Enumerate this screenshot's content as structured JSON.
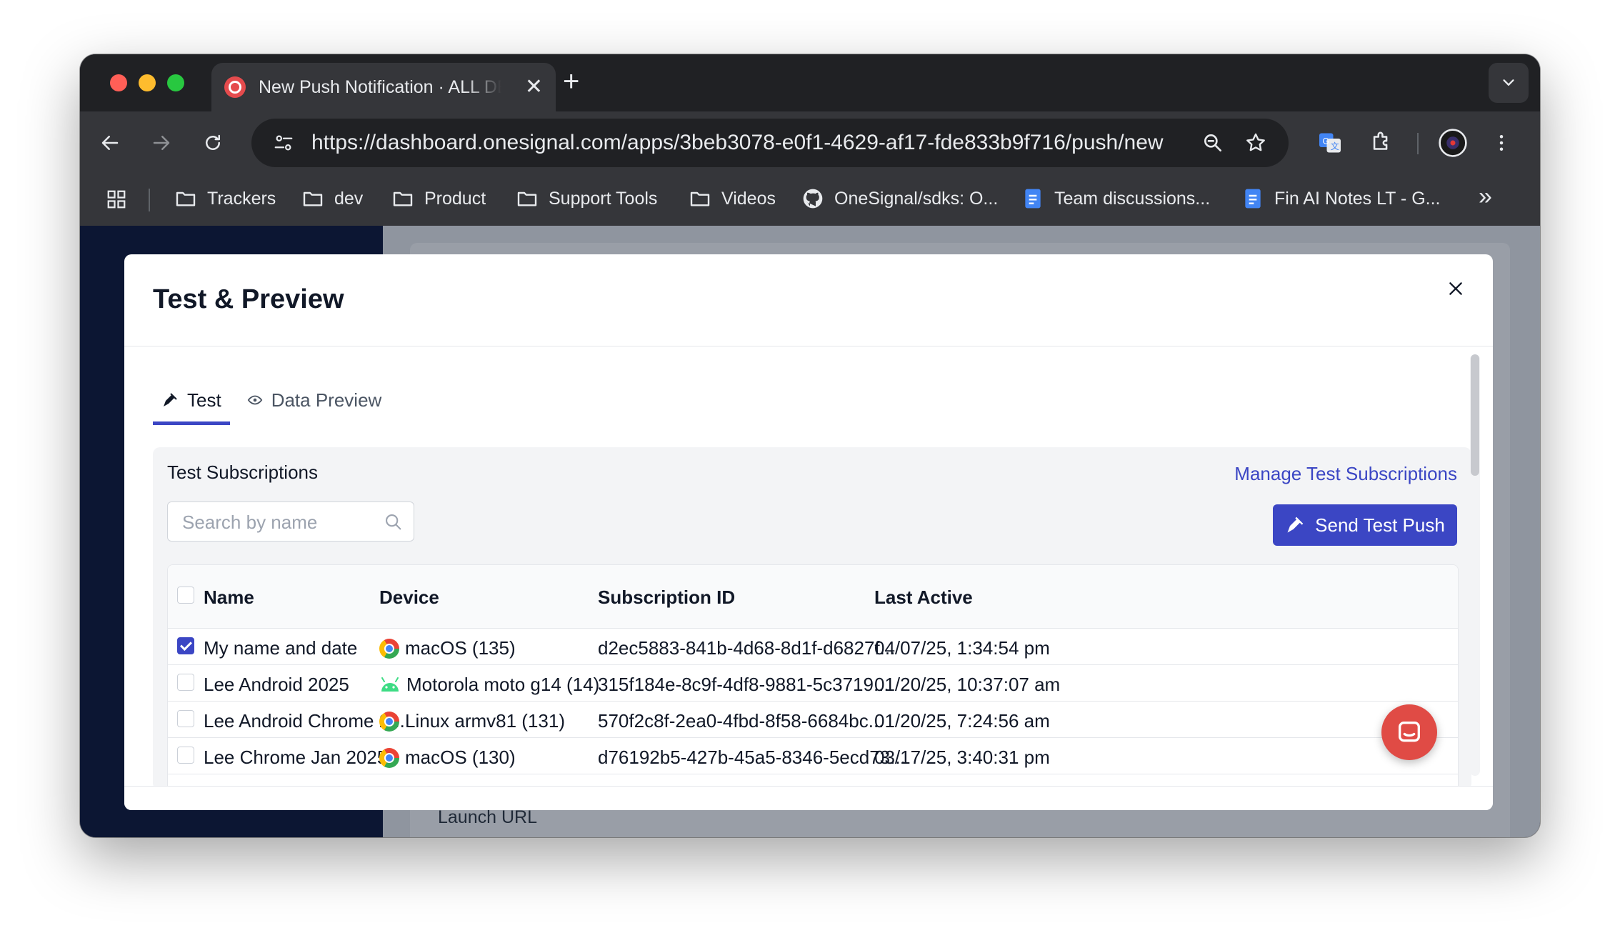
{
  "browser": {
    "tab_title": "New Push Notification · ALL DEVICES",
    "tab_close": "✕",
    "new_tab": "+",
    "url": "https://dashboard.onesignal.com/apps/3beb3078-e0f1-4629-af17-fde833b9f716/push/new",
    "bookmarks": [
      "Trackers",
      "dev",
      "Product",
      "Support Tools",
      "Videos",
      "OneSignal/sdks: O...",
      "Team discussions...",
      "Fin AI Notes LT - G..."
    ],
    "more_bookmarks": "»"
  },
  "page": {
    "launch_url_label": "Launch URL"
  },
  "modal": {
    "title": "Test & Preview",
    "tabs": [
      {
        "label": "Test",
        "icon": "send-icon",
        "active": true
      },
      {
        "label": "Data Preview",
        "icon": "eye-icon",
        "active": false
      }
    ],
    "section_title": "Test Subscriptions",
    "manage_link": "Manage Test Subscriptions",
    "search_placeholder": "Search by name",
    "send_button": "Send Test Push",
    "columns": [
      "Name",
      "Device",
      "Subscription ID",
      "Last Active"
    ],
    "rows": [
      {
        "checked": true,
        "name": "My name and date",
        "device_icon": "chrome-icon",
        "device": "macOS (135)",
        "subscription_id": "d2ec5883-841b-4d68-8d1f-d6827f...",
        "last_active": "04/07/25, 1:34:54 pm"
      },
      {
        "checked": false,
        "name": "Lee Android 2025",
        "device_icon": "android-icon",
        "device": "Motorola moto g14 (14)",
        "subscription_id": "315f184e-8c9f-4df8-9881-5c3719...",
        "last_active": "01/20/25, 10:37:07 am"
      },
      {
        "checked": false,
        "name": "Lee Android Chrome 2...",
        "device_icon": "chrome-icon",
        "device": "Linux armv81 (131)",
        "subscription_id": "570f2c8f-2ea0-4fbd-8f58-6684bc...",
        "last_active": "01/20/25, 7:24:56 am"
      },
      {
        "checked": false,
        "name": "Lee Chrome Jan 2025",
        "device_icon": "chrome-icon",
        "device": "macOS (130)",
        "subscription_id": "d76192b5-427b-45a5-8346-5ecd73...",
        "last_active": "03/17/25, 3:40:31 pm"
      }
    ]
  },
  "colors": {
    "accent": "#3b46c4",
    "chat": "#e04b45"
  }
}
